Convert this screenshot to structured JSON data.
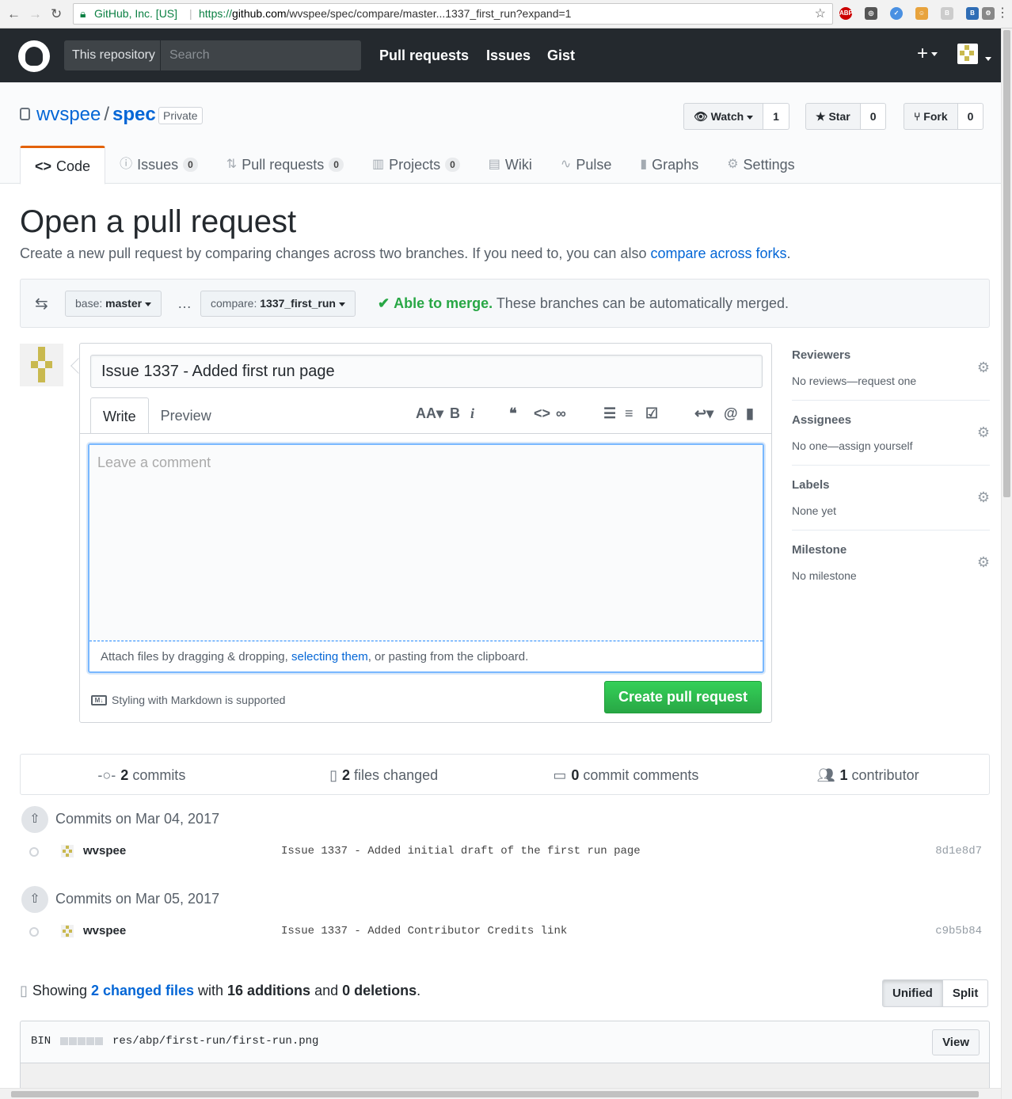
{
  "browser": {
    "org": "GitHub, Inc. [US]",
    "url_prefix": "https://",
    "url_host": "github.com",
    "url_path": "/wvspee/spec/compare/master...1337_first_run?expand=1"
  },
  "header": {
    "search_scope": "This repository",
    "search_placeholder": "Search",
    "nav": [
      "Pull requests",
      "Issues",
      "Gist"
    ]
  },
  "repo": {
    "owner": "wvspee",
    "name": "spec",
    "visibility": "Private",
    "watch_label": "Watch",
    "watch_count": "1",
    "star_label": "Star",
    "star_count": "0",
    "fork_label": "Fork",
    "fork_count": "0",
    "tabs": [
      {
        "label": "Code",
        "count": ""
      },
      {
        "label": "Issues",
        "count": "0"
      },
      {
        "label": "Pull requests",
        "count": "0"
      },
      {
        "label": "Projects",
        "count": "0"
      },
      {
        "label": "Wiki",
        "count": ""
      },
      {
        "label": "Pulse",
        "count": ""
      },
      {
        "label": "Graphs",
        "count": ""
      },
      {
        "label": "Settings",
        "count": ""
      }
    ]
  },
  "page": {
    "title": "Open a pull request",
    "subtitle": "Create a new pull request by comparing changes across two branches. If you need to, you can also ",
    "subtitle_link": "compare across forks",
    "subtitle_end": "."
  },
  "compare": {
    "base_label": "base:",
    "base_branch": "master",
    "ellipsis": "…",
    "compare_label": "compare:",
    "compare_branch": "1337_first_run",
    "merge_status": "Able to merge.",
    "merge_text": " These branches can be automatically merged."
  },
  "form": {
    "title_value": "Issue 1337 - Added first run page",
    "tab_write": "Write",
    "tab_preview": "Preview",
    "comment_placeholder": "Leave a comment",
    "attach_text_1": "Attach files by dragging & dropping, ",
    "attach_link": "selecting them",
    "attach_text_2": ", or pasting from the clipboard.",
    "markdown_note": "Styling with Markdown is supported",
    "submit_label": "Create pull request"
  },
  "sidebar": {
    "sections": [
      {
        "heading": "Reviewers",
        "value": "No reviews—request one"
      },
      {
        "heading": "Assignees",
        "value": "No one—assign yourself"
      },
      {
        "heading": "Labels",
        "value": "None yet"
      },
      {
        "heading": "Milestone",
        "value": "No milestone"
      }
    ]
  },
  "summary": {
    "commits_count": "2",
    "commits_label": " commits",
    "files_count": "2",
    "files_label": " files changed",
    "comments_count": "0",
    "comments_label": " commit comments",
    "contributors_count": "1",
    "contributors_label": " contributor"
  },
  "commit_groups": [
    {
      "date": "Commits on Mar 04, 2017",
      "author": "wvspee",
      "message": "Issue 1337 - Added initial draft of the first run page",
      "sha": "8d1e8d7"
    },
    {
      "date": "Commits on Mar 05, 2017",
      "author": "wvspee",
      "message": "Issue 1337 - Added Contributor Credits link",
      "sha": "c9b5b84"
    }
  ],
  "diff": {
    "showing": "Showing ",
    "changed_files": "2 changed files",
    "with": " with ",
    "additions": "16 additions",
    "and": " and ",
    "deletions": "0 deletions",
    "end": ".",
    "unified_label": "Unified",
    "split_label": "Split",
    "file_type": "BIN",
    "file_path": "res/abp/first-run/first-run.png",
    "view_label": "View"
  }
}
